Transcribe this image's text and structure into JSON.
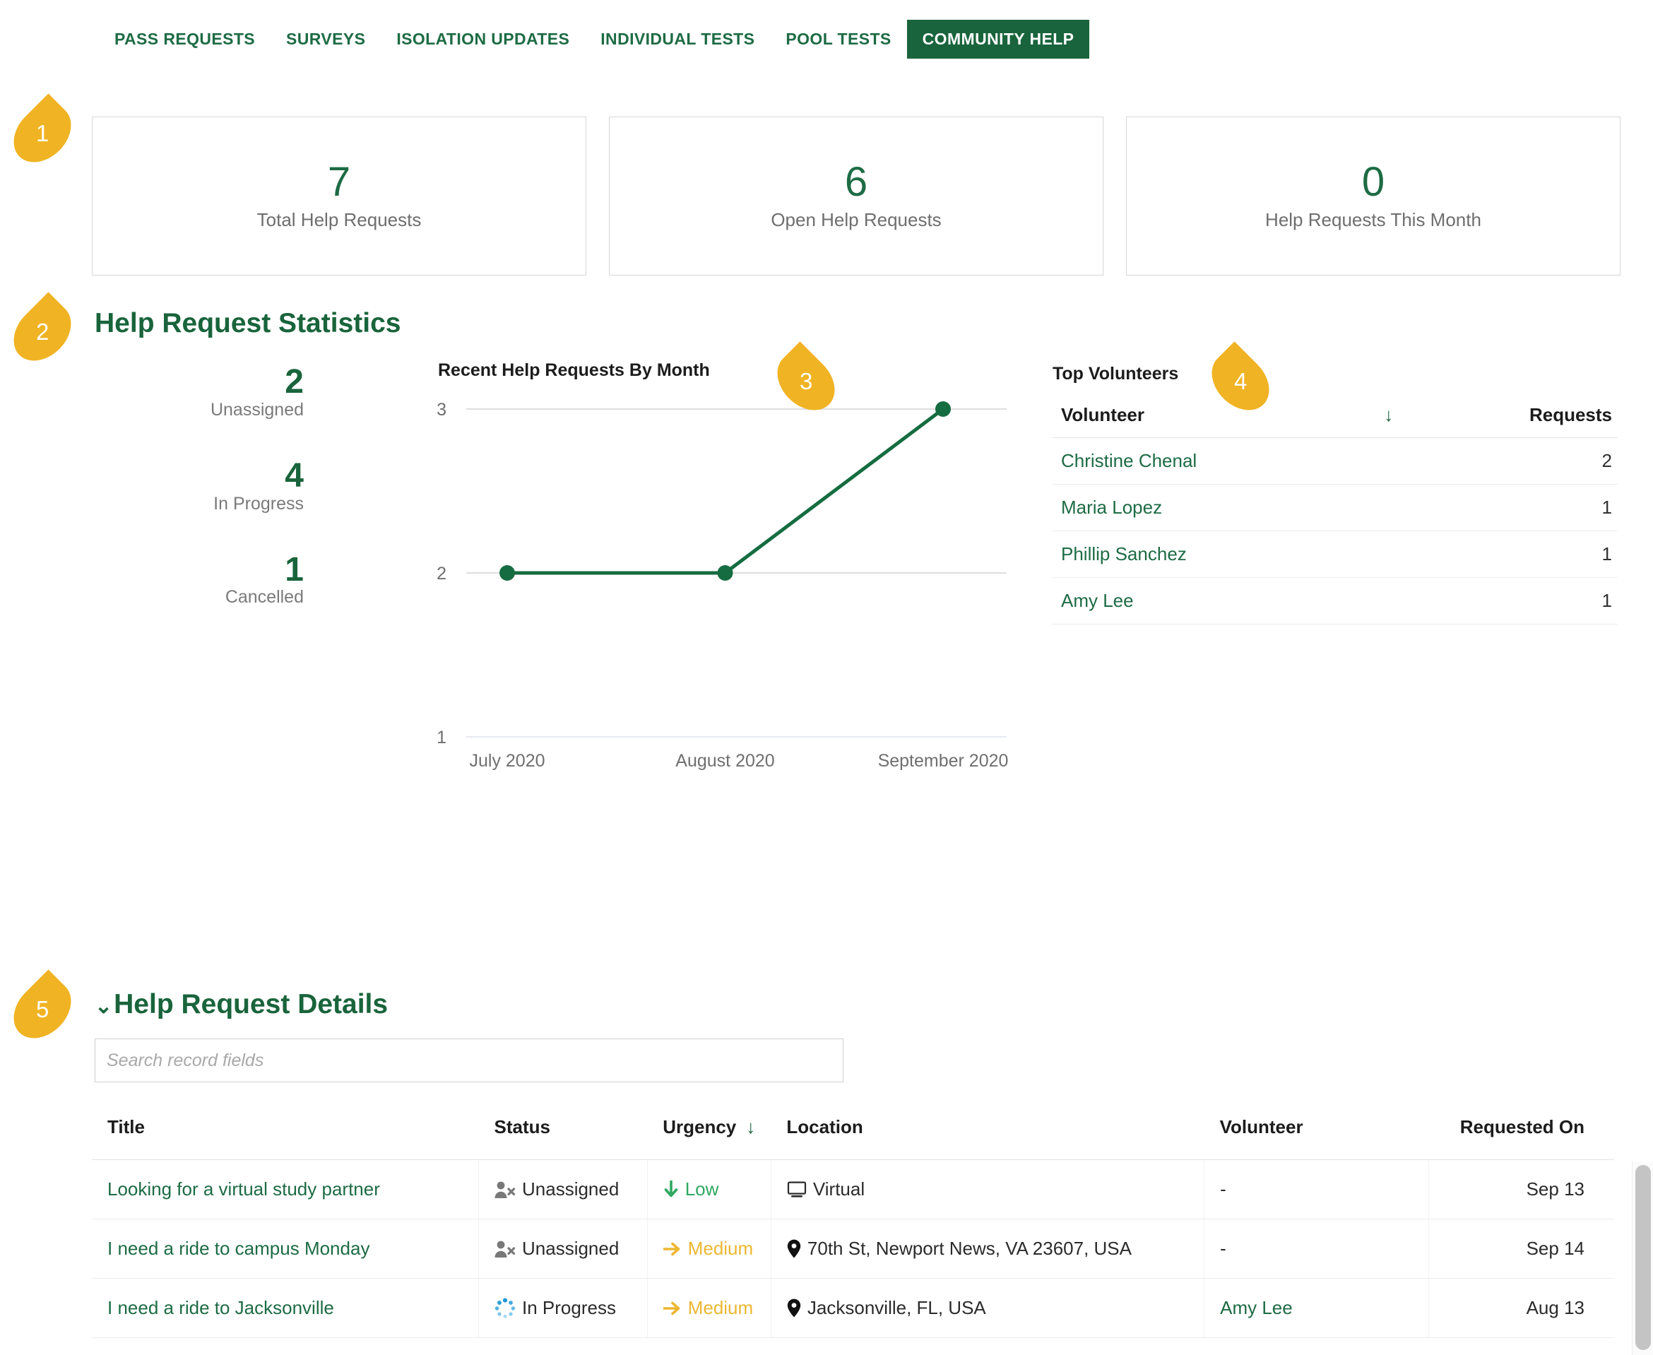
{
  "nav": {
    "tabs": [
      {
        "label": "PASS REQUESTS",
        "active": false
      },
      {
        "label": "SURVEYS",
        "active": false
      },
      {
        "label": "ISOLATION UPDATES",
        "active": false
      },
      {
        "label": "INDIVIDUAL TESTS",
        "active": false
      },
      {
        "label": "POOL TESTS",
        "active": false
      },
      {
        "label": "COMMUNITY HELP",
        "active": true
      }
    ]
  },
  "callouts": [
    {
      "number": "1",
      "direction": "right"
    },
    {
      "number": "2",
      "direction": "right"
    },
    {
      "number": "3",
      "direction": "left"
    },
    {
      "number": "4",
      "direction": "left"
    },
    {
      "number": "5",
      "direction": "right"
    }
  ],
  "cards": [
    {
      "value": "7",
      "label": "Total Help Requests"
    },
    {
      "value": "6",
      "label": "Open Help Requests"
    },
    {
      "value": "0",
      "label": "Help Requests This Month"
    }
  ],
  "statistics": {
    "title": "Help Request Statistics",
    "ministats": [
      {
        "value": "2",
        "label": "Unassigned"
      },
      {
        "value": "4",
        "label": "In Progress"
      },
      {
        "value": "1",
        "label": "Cancelled"
      }
    ]
  },
  "chart_data": {
    "type": "line",
    "title": "Recent Help Requests By Month",
    "categories": [
      "July 2020",
      "August 2020",
      "September 2020"
    ],
    "values": [
      2,
      2,
      3
    ],
    "series": [
      {
        "name": "Help Requests",
        "values": [
          2,
          2,
          3
        ]
      }
    ],
    "xlabel": "",
    "ylabel": "",
    "yticks": [
      1,
      2,
      3
    ],
    "ylim": [
      1,
      3
    ],
    "grid": true,
    "legend": "none",
    "line_color": "#156c41",
    "marker": "circle"
  },
  "volunteers": {
    "title": "Top Volunteers",
    "columns": {
      "name": "Volunteer",
      "sort": "↓",
      "requests": "Requests"
    },
    "rows": [
      {
        "name": "Christine Chenal",
        "requests": "2"
      },
      {
        "name": "Maria Lopez",
        "requests": "1"
      },
      {
        "name": "Phillip Sanchez",
        "requests": "1"
      },
      {
        "name": "Amy Lee",
        "requests": "1"
      }
    ]
  },
  "details": {
    "title": "Help Request Details",
    "chevron": "⌄",
    "search_placeholder": "Search record fields",
    "search_value": "",
    "columns": {
      "title": "Title",
      "status": "Status",
      "urgency": "Urgency",
      "urgency_sort": "↓",
      "location": "Location",
      "volunteer": "Volunteer",
      "requested_on": "Requested On"
    },
    "rows": [
      {
        "title": "Looking for a virtual study partner",
        "status": "Unassigned",
        "status_icon": "user-times-icon",
        "urgency": "Low",
        "urgency_icon": "arrow-down-icon",
        "urgency_level": "low",
        "location": "Virtual",
        "location_icon": "monitor-icon",
        "volunteer": "-",
        "volunteer_link": false,
        "requested_on": "Sep 13"
      },
      {
        "title": "I need a ride to campus Monday",
        "status": "Unassigned",
        "status_icon": "user-times-icon",
        "urgency": "Medium",
        "urgency_icon": "arrow-right-icon",
        "urgency_level": "medium",
        "location": "70th St, Newport News, VA 23607, USA",
        "location_icon": "map-pin-icon",
        "volunteer": "-",
        "volunteer_link": false,
        "requested_on": "Sep 14"
      },
      {
        "title": "I need a ride to Jacksonville",
        "status": "In Progress",
        "status_icon": "spinner-icon",
        "urgency": "Medium",
        "urgency_icon": "arrow-right-icon",
        "urgency_level": "medium",
        "location": "Jacksonville, FL, USA",
        "location_icon": "map-pin-icon",
        "volunteer": "Amy Lee",
        "volunteer_link": true,
        "requested_on": "Aug 13"
      }
    ]
  },
  "colors": {
    "brand_green": "#19643c",
    "link_green": "#1d6b44",
    "accent_yellow": "#f0b323",
    "urgency_low": "#2fa860",
    "urgency_medium": "#ecb731",
    "chart_line": "#156c41"
  }
}
